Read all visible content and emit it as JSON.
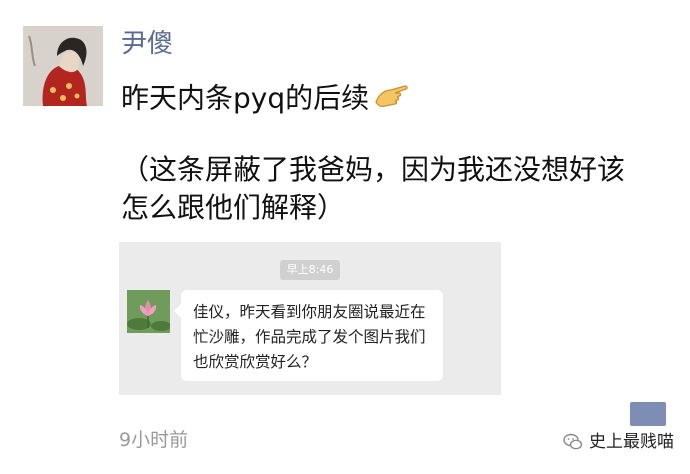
{
  "post": {
    "username": "尹傻",
    "line1": "昨天内条pyq的后续",
    "line2": "（这条屏蔽了我爸妈，因为我还没想好该",
    "line3": "怎么跟他们解释）",
    "emoji": "hand-pointing-icon",
    "timestamp": "9小时前"
  },
  "screenshot": {
    "time_pill": "早上8:46",
    "bubble_lines": [
      "佳仪，昨天看到你朋友圈说最近在",
      "忙沙雕，作品完成了发个图片我们",
      "也欣赏欣赏好么？"
    ]
  },
  "watermark": {
    "text": "史上最贱喵"
  },
  "colors": {
    "username": "#5b6a91",
    "timestamp": "#9a9a9a",
    "screenshot_bg": "#ebebeb",
    "more_button": "#7d8db3"
  }
}
